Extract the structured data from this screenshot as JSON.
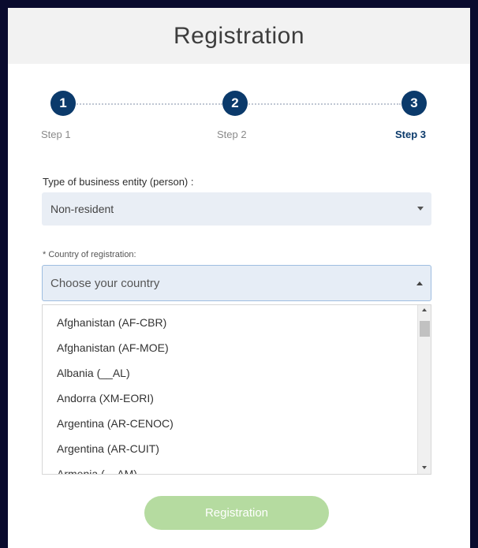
{
  "header": {
    "title": "Registration"
  },
  "stepper": {
    "steps": [
      {
        "number": "1",
        "label": "Step 1"
      },
      {
        "number": "2",
        "label": "Step 2"
      },
      {
        "number": "3",
        "label": "Step 3"
      }
    ],
    "active_step": 3
  },
  "form": {
    "entity_label": "Type of business entity (person) :",
    "entity_value": "Non-resident",
    "country_label": "* Country of registration:",
    "country_placeholder": "Choose your country",
    "country_options": [
      "Afghanistan (AF-CBR)",
      "Afghanistan (AF-MOE)",
      "Albania (__AL)",
      "Andorra (XM-EORI)",
      "Argentina (AR-CENOC)",
      "Argentina (AR-CUIT)",
      "Armenia (__AM)"
    ],
    "submit_label": "Registration"
  },
  "colors": {
    "step_active": "#0b3a6b",
    "button_disabled": "#b5dba0",
    "background": "#0a0b2e"
  }
}
